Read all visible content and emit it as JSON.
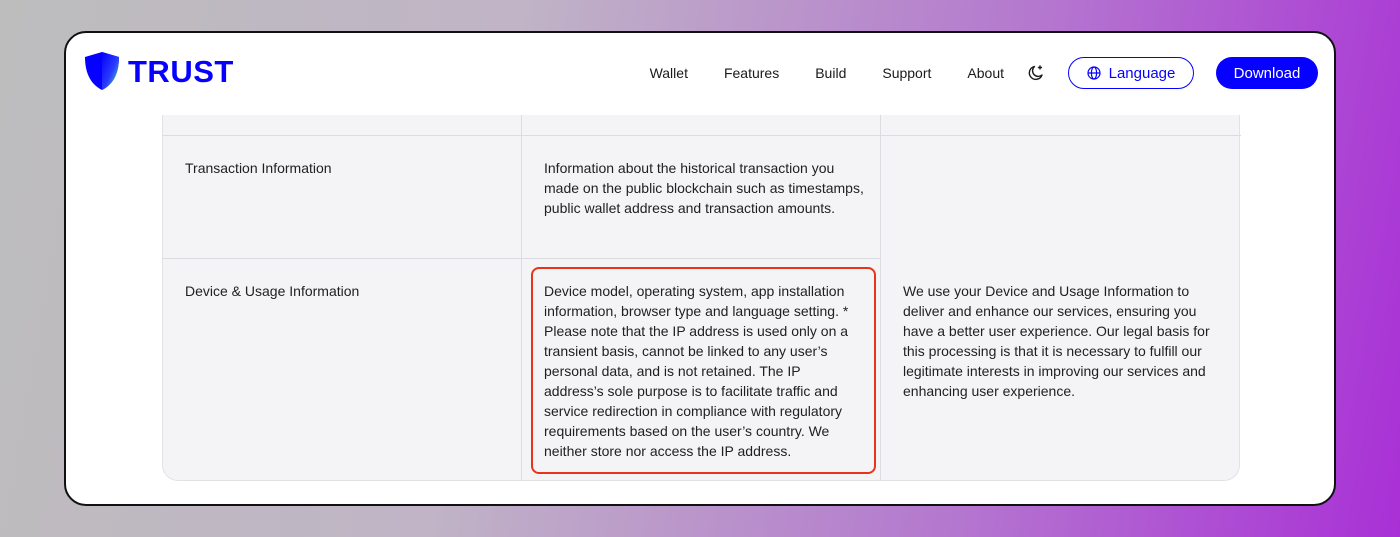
{
  "brand": {
    "name": "TRUST",
    "color": "#0500ff"
  },
  "nav": {
    "links": [
      "Wallet",
      "Features",
      "Build",
      "Support",
      "About"
    ],
    "theme_icon": "moon-sparkle-icon",
    "language_label": "Language",
    "download_label": "Download"
  },
  "table": {
    "rows": [
      {
        "label": "Transaction Information",
        "data": "Information about the historical transaction you made on the public blockchain such as timestamps, public wallet address and transaction amounts.",
        "purpose": ""
      },
      {
        "label": "Device & Usage Information",
        "data": "Device model, operating system, app installation information, browser type and language setting. * Please note that the IP address is used only on a transient basis, cannot be linked to any user’s personal data, and is not retained. The IP address’s sole purpose is to facilitate traffic and service redirection in compliance with regulatory requirements based on the user’s country. We neither store nor access the IP address.",
        "purpose": "We use your Device and Usage Information to deliver and enhance our services, ensuring you have a better user experience. Our legal basis for this processing is that it is necessary to fulfill our legitimate interests in improving our services and enhancing user experience."
      }
    ],
    "highlight_color": "#e8331f"
  }
}
